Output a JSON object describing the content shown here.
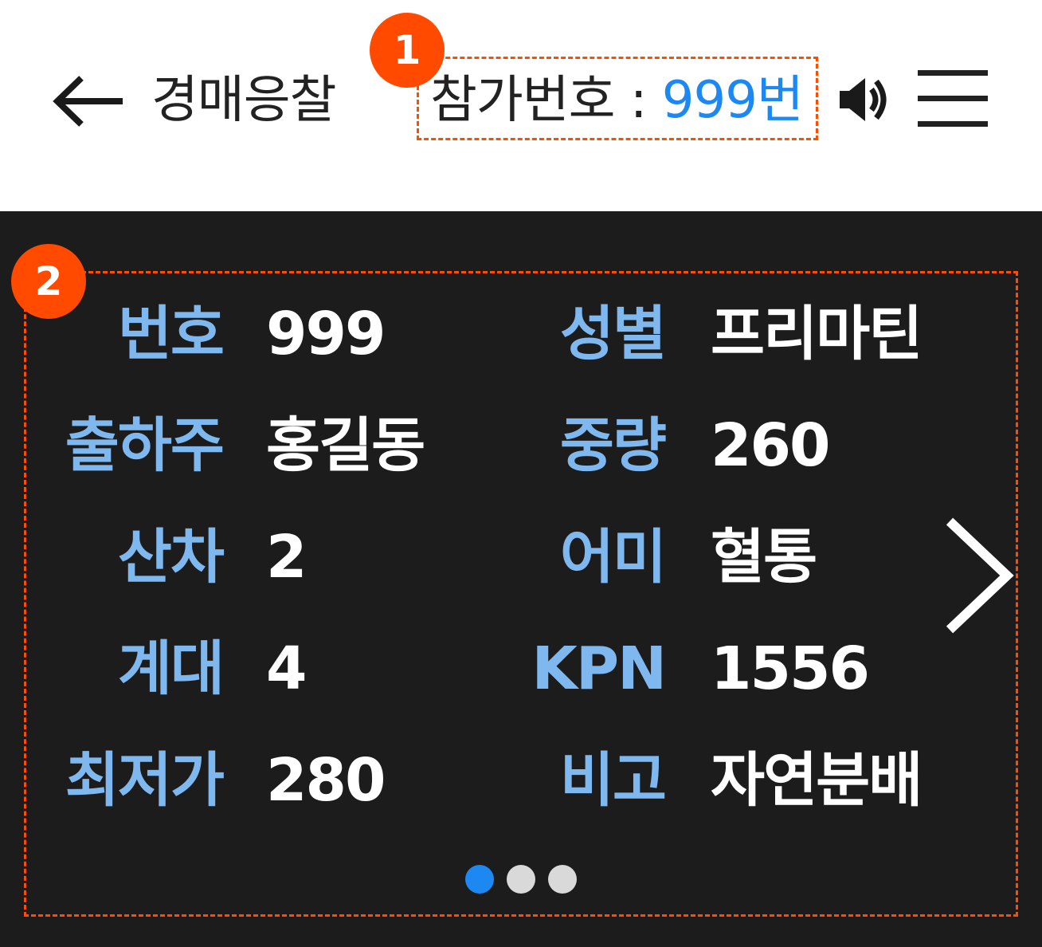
{
  "header": {
    "title": "경매응찰",
    "participant_label": "참가번호 : ",
    "participant_number": "999번",
    "icons": {
      "back": "back-arrow-icon",
      "sound": "speaker-icon",
      "menu": "hamburger-menu-icon"
    }
  },
  "annotations": {
    "badge_1": "1",
    "badge_2": "2"
  },
  "info": {
    "left": [
      {
        "label": "번호",
        "value": "999"
      },
      {
        "label": "출하주",
        "value": "홍길동"
      },
      {
        "label": "산차",
        "value": "2"
      },
      {
        "label": "계대",
        "value": "4"
      },
      {
        "label": "최저가",
        "value": "280"
      }
    ],
    "right": [
      {
        "label": "성별",
        "value": "프리마틴"
      },
      {
        "label": "중량",
        "value": "260"
      },
      {
        "label": "어미",
        "value": "혈통"
      },
      {
        "label": "KPN",
        "value": "1556"
      },
      {
        "label": "비고",
        "value": "자연분배"
      }
    ]
  },
  "pager": {
    "total": 3,
    "active_index": 1
  },
  "colors": {
    "accent_blue": "#1e88f2",
    "label_blue": "#7fb8ee",
    "annotation_orange": "#ff4a00",
    "panel_bg": "#1c1c1c"
  }
}
